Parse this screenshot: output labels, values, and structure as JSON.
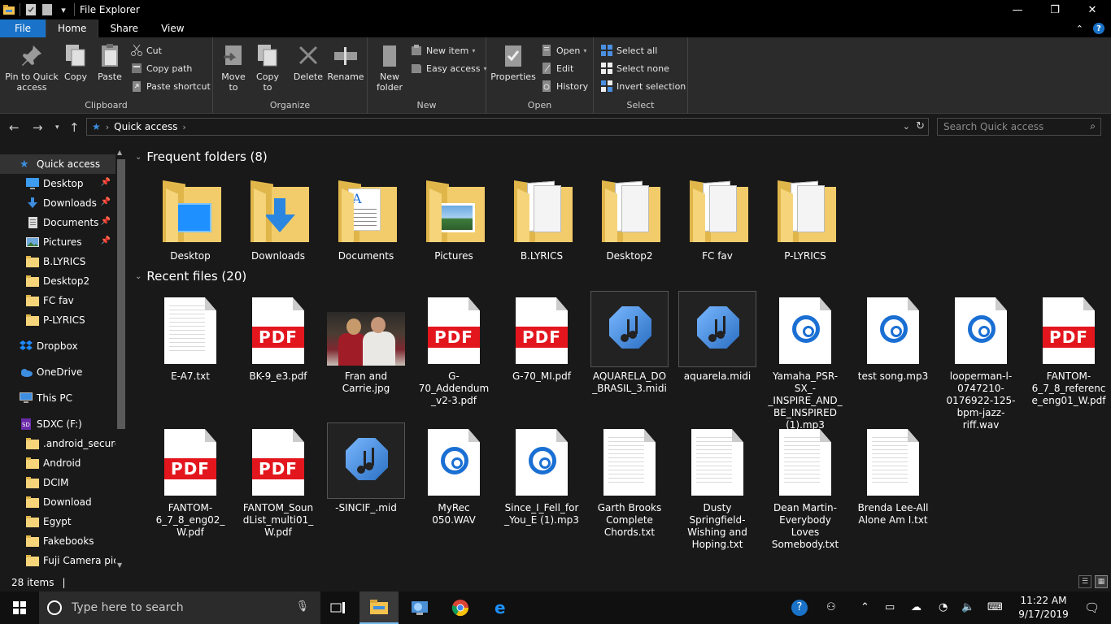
{
  "window": {
    "title": "File Explorer",
    "minimize": "—",
    "maximize": "❐",
    "close": "✕"
  },
  "ribbon_tabs": [
    "File",
    "Home",
    "Share",
    "View"
  ],
  "ribbon": {
    "clipboard": {
      "label": "Clipboard",
      "pin": "Pin to Quick access",
      "copy": "Copy",
      "paste": "Paste",
      "cut": "Cut",
      "copy_path": "Copy path",
      "paste_shortcut": "Paste shortcut"
    },
    "organize": {
      "label": "Organize",
      "move_to": "Move to",
      "copy_to": "Copy to",
      "delete": "Delete",
      "rename": "Rename"
    },
    "new": {
      "label": "New",
      "new_folder": "New folder",
      "new_item": "New item",
      "easy_access": "Easy access"
    },
    "open": {
      "label": "Open",
      "properties": "Properties",
      "open": "Open",
      "edit": "Edit",
      "history": "History"
    },
    "select": {
      "label": "Select",
      "select_all": "Select all",
      "select_none": "Select none",
      "invert": "Invert selection"
    }
  },
  "address": {
    "crumb": "Quick access",
    "search_placeholder": "Search Quick access"
  },
  "nav": [
    {
      "label": "Quick access",
      "icon": "star-icon",
      "pinned": false,
      "indent": 1,
      "selected": true
    },
    {
      "label": "Desktop",
      "icon": "desktop-icon",
      "pinned": true,
      "indent": 2
    },
    {
      "label": "Downloads",
      "icon": "download-icon",
      "pinned": true,
      "indent": 2
    },
    {
      "label": "Documents",
      "icon": "documents-icon",
      "pinned": true,
      "indent": 2
    },
    {
      "label": "Pictures",
      "icon": "pictures-icon",
      "pinned": true,
      "indent": 2
    },
    {
      "label": "B.LYRICS",
      "icon": "folder-icon",
      "pinned": false,
      "indent": 2
    },
    {
      "label": "Desktop2",
      "icon": "folder-icon",
      "pinned": false,
      "indent": 2
    },
    {
      "label": "FC fav",
      "icon": "folder-icon",
      "pinned": false,
      "indent": 2
    },
    {
      "label": "P-LYRICS",
      "icon": "folder-icon",
      "pinned": false,
      "indent": 2
    },
    {
      "label": "Dropbox",
      "icon": "dropbox-icon",
      "pinned": false,
      "indent": 1,
      "gap": true
    },
    {
      "label": "OneDrive",
      "icon": "onedrive-icon",
      "pinned": false,
      "indent": 1,
      "gap": true
    },
    {
      "label": "This PC",
      "icon": "pc-icon",
      "pinned": false,
      "indent": 1,
      "gap": true
    },
    {
      "label": "SDXC (F:)",
      "icon": "sdcard-icon",
      "pinned": false,
      "indent": 1,
      "gap": true
    },
    {
      "label": ".android_secure",
      "icon": "folder-icon",
      "pinned": false,
      "indent": 2
    },
    {
      "label": "Android",
      "icon": "folder-icon",
      "pinned": false,
      "indent": 2
    },
    {
      "label": "DCIM",
      "icon": "folder-icon",
      "pinned": false,
      "indent": 2
    },
    {
      "label": "Download",
      "icon": "folder-icon",
      "pinned": false,
      "indent": 2
    },
    {
      "label": "Egypt",
      "icon": "folder-icon",
      "pinned": false,
      "indent": 2
    },
    {
      "label": "Fakebooks",
      "icon": "folder-icon",
      "pinned": false,
      "indent": 2
    },
    {
      "label": "Fuji Camera pics",
      "icon": "folder-icon",
      "pinned": false,
      "indent": 2
    }
  ],
  "frequent": {
    "heading": "Frequent folders (8)",
    "items": [
      {
        "label": "Desktop",
        "overlay": "desktop"
      },
      {
        "label": "Downloads",
        "overlay": "download"
      },
      {
        "label": "Documents",
        "overlay": "document"
      },
      {
        "label": "Pictures",
        "overlay": "picture"
      },
      {
        "label": "B.LYRICS",
        "overlay": "papers"
      },
      {
        "label": "Desktop2",
        "overlay": "papers"
      },
      {
        "label": "FC fav",
        "overlay": "papers"
      },
      {
        "label": "P-LYRICS",
        "overlay": "papers"
      }
    ]
  },
  "recent": {
    "heading": "Recent files (20)",
    "pdf_text": "PDF",
    "items": [
      {
        "label": "E-A7.txt",
        "kind": "txt"
      },
      {
        "label": "BK-9_e3.pdf",
        "kind": "pdf"
      },
      {
        "label": "Fran and Carrie.jpg",
        "kind": "jpg"
      },
      {
        "label": "G-70_Addendum_v2-3.pdf",
        "kind": "pdf"
      },
      {
        "label": "G-70_MI.pdf",
        "kind": "pdf"
      },
      {
        "label": "AQUARELA_DO_BRASIL_3.midi",
        "kind": "midi",
        "selected": true
      },
      {
        "label": "aquarela.midi",
        "kind": "midi",
        "selected": true
      },
      {
        "label": "Yamaha_PSR-SX_-_INSPIRE_AND_BE_INSPIRED (1).mp3",
        "kind": "audio"
      },
      {
        "label": "test song.mp3",
        "kind": "audio"
      },
      {
        "label": "looperman-l-0747210-0176922-125-bpm-jazz-riff.wav",
        "kind": "audio"
      },
      {
        "label": "FANTOM-6_7_8_reference_eng01_W.pdf",
        "kind": "pdf"
      },
      {
        "label": "FANTOM-6_7_8_eng02_W.pdf",
        "kind": "pdf"
      },
      {
        "label": "FANTOM_SoundList_multi01_W.pdf",
        "kind": "pdf"
      },
      {
        "label": "-SINCIF_.mid",
        "kind": "midi",
        "selected": true
      },
      {
        "label": "MyRec 050.WAV",
        "kind": "audio"
      },
      {
        "label": "Since_I_Fell_for_You_E (1).mp3",
        "kind": "audio"
      },
      {
        "label": "Garth Brooks Complete Chords.txt",
        "kind": "txt"
      },
      {
        "label": "Dusty Springfield-Wishing and Hoping.txt",
        "kind": "txt"
      },
      {
        "label": "Dean Martin-Everybody Loves Somebody.txt",
        "kind": "txt"
      },
      {
        "label": "Brenda Lee-All Alone Am I.txt",
        "kind": "txt"
      }
    ]
  },
  "status": {
    "count": "28 items",
    "separator": "|"
  },
  "taskbar": {
    "search_placeholder": "Type here to search",
    "time": "11:22 AM",
    "date": "9/17/2019"
  },
  "colors": {
    "accent": "#1a73c8",
    "folder": "#f6d47a",
    "pdf_red": "#e3161e",
    "audio_blue": "#1a6fd3"
  }
}
